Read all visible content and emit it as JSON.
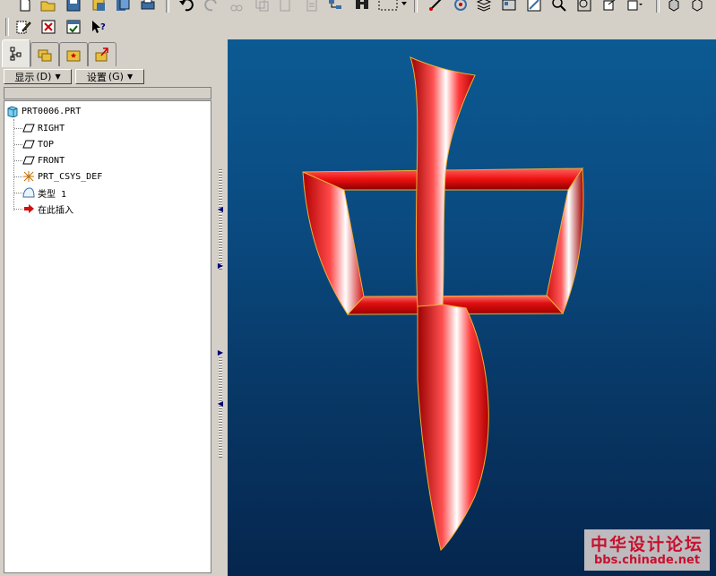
{
  "panel": {
    "show_menu_label": "显示",
    "show_menu_key": "(D)",
    "settings_menu_label": "设置",
    "settings_menu_key": "(G)"
  },
  "model_tree": {
    "root": "PRT0006.PRT",
    "items": [
      {
        "label": "RIGHT",
        "icon": "datum-plane-icon"
      },
      {
        "label": "TOP",
        "icon": "datum-plane-icon"
      },
      {
        "label": "FRONT",
        "icon": "datum-plane-icon"
      },
      {
        "label": "PRT_CSYS_DEF",
        "icon": "coordinate-system-icon"
      },
      {
        "label": "类型 1",
        "icon": "style-feature-icon"
      },
      {
        "label": "在此插入",
        "icon": "insert-here-arrow-icon"
      }
    ]
  },
  "watermark": {
    "title": "中华设计论坛",
    "url": "bbs.chinade.net"
  },
  "colors": {
    "viewport_top": "#0c5a93",
    "viewport_bottom": "#05264e",
    "model": "#e01010",
    "watermark": "#c8102e"
  }
}
